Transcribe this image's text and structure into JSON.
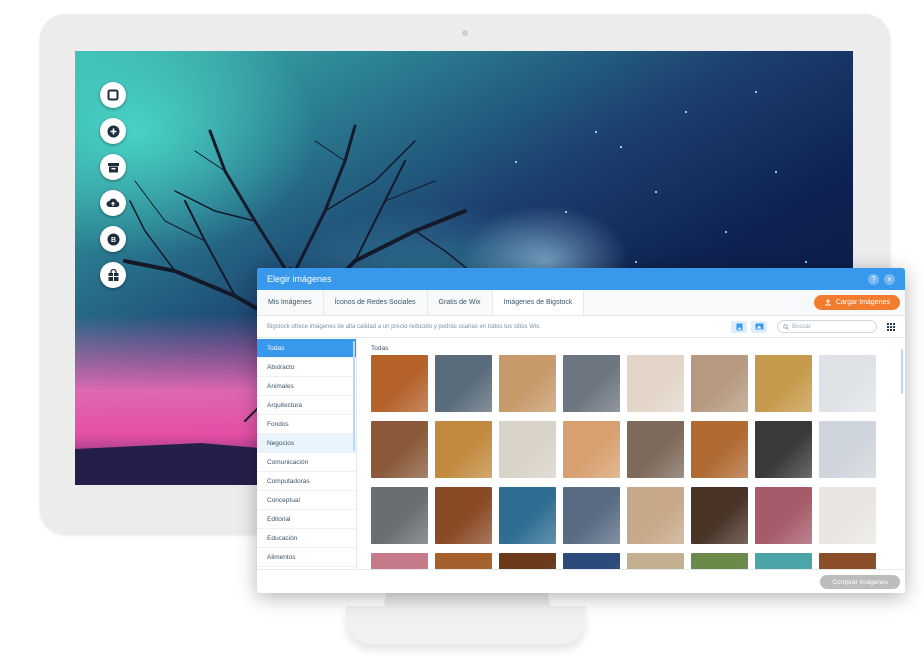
{
  "dialog": {
    "title": "Elegir imágenes",
    "help_icon": "?",
    "close_icon": "×",
    "tabs": [
      {
        "label": "Mis Imágenes"
      },
      {
        "label": "Íconos de Redes Sociales"
      },
      {
        "label": "Gratis de Wix"
      },
      {
        "label": "Imágenes de Bigstock"
      }
    ],
    "active_tab": "Imágenes de Bigstock",
    "upload_label": "Cargar Imágenes",
    "info_text": "Bigstock ofrece imágenes de alta calidad a un precio reducido y podrás usarlas en todos tus sitios Wix.",
    "search_placeholder": "Buscar",
    "categories": [
      {
        "label": "Todas"
      },
      {
        "label": "Abstracto"
      },
      {
        "label": "Animales"
      },
      {
        "label": "Arquitectura"
      },
      {
        "label": "Fondos"
      },
      {
        "label": "Negocios"
      },
      {
        "label": "Comunicación"
      },
      {
        "label": "Computadoras"
      },
      {
        "label": "Conceptual"
      },
      {
        "label": "Editorial"
      },
      {
        "label": "Educación"
      },
      {
        "label": "Alimentos"
      }
    ],
    "active_category": "Todas",
    "grid_title": "Todas",
    "buy_label": "Comprar Imágenes"
  },
  "editor_toolbar": [
    "background-icon",
    "add-icon",
    "apps-icon",
    "upload-icon",
    "blog-icon",
    "store-icon"
  ],
  "colors": {
    "accent": "#3899ec",
    "upload_button": "#f27d2f",
    "buy_button": "#bcbcbc"
  },
  "thumbnails": [
    "#b4612a",
    "#5a6b7a",
    "#c79a6a",
    "#6d7580",
    "#e3d6c8",
    "#b79a80",
    "#c59a4a",
    "#dfe3e8",
    "#8a5a3a",
    "#c28a40",
    "#d9d2c8",
    "#d8a070",
    "#7d6a5a",
    "#b06a32",
    "#3a3a3a",
    "#cfd5dc",
    "#6a6e72",
    "#8a4a26",
    "#2f6e92",
    "#5a6c84",
    "#c7a888",
    "#4a3428",
    "#a65a6a",
    "#e9e6e2",
    "#c57a8a",
    "#a4612e",
    "#6a3a1a",
    "#2c4a7a",
    "#c2b090",
    "#6a8a4a",
    "#4aa4a8",
    "#8a4e2a"
  ]
}
